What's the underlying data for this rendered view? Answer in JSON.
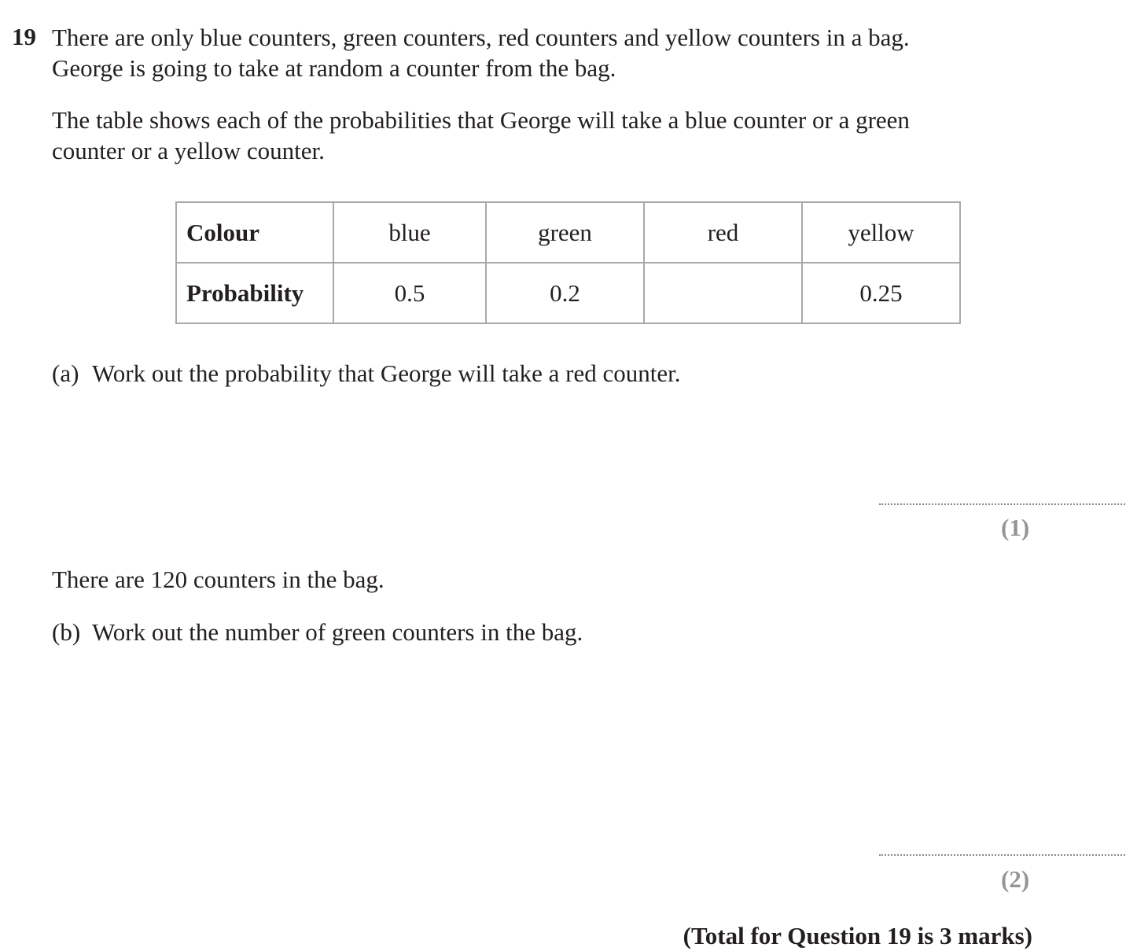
{
  "question": {
    "number": "19",
    "intro_line1": "There are only blue counters, green counters, red counters and yellow counters in a bag.",
    "intro_line2": "George is going to take at random a counter from the bag.",
    "table_intro_line1": "The table shows each of the probabilities that George will take a blue counter or a green",
    "table_intro_line2": "counter or a yellow counter."
  },
  "table": {
    "header_label": "Colour",
    "value_label": "Probability",
    "colours": [
      "blue",
      "green",
      "red",
      "yellow"
    ],
    "probabilities": [
      "0.5",
      "0.2",
      "",
      "0.25"
    ]
  },
  "part_a": {
    "label": "(a)",
    "text": "Work out the probability that George will take a red counter.",
    "marks": "(1)"
  },
  "context_b": "There are 120 counters in the bag.",
  "part_b": {
    "label": "(b)",
    "text": "Work out the number of green counters in the bag.",
    "marks": "(2)"
  },
  "total": "(Total for Question 19 is 3 marks)"
}
